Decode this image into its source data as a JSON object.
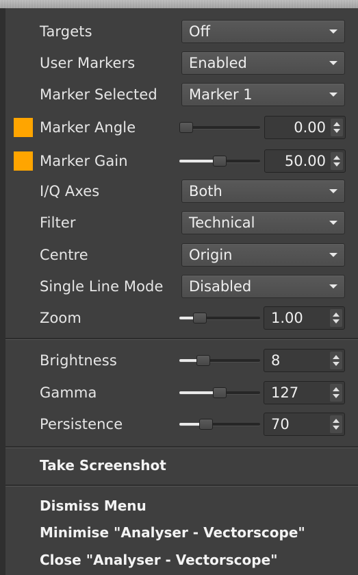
{
  "menu": {
    "targets": {
      "label": "Targets",
      "value": "Off"
    },
    "user_markers": {
      "label": "User Markers",
      "value": "Enabled"
    },
    "marker_selected": {
      "label": "Marker Selected",
      "value": "Marker 1"
    },
    "marker_angle": {
      "label": "Marker Angle",
      "value": "0.00",
      "slider_fraction": 0.0,
      "swatch_color": "#ffa500"
    },
    "marker_gain": {
      "label": "Marker Gain",
      "value": "50.00",
      "slider_fraction": 0.5,
      "swatch_color": "#ffa500"
    },
    "iq_axes": {
      "label": "I/Q Axes",
      "value": "Both"
    },
    "filter": {
      "label": "Filter",
      "value": "Technical"
    },
    "centre": {
      "label": "Centre",
      "value": "Origin"
    },
    "single_line_mode": {
      "label": "Single Line Mode",
      "value": "Disabled"
    },
    "zoom": {
      "label": "Zoom",
      "value": "1.00",
      "slider_fraction": 0.2
    },
    "brightness": {
      "label": "Brightness",
      "value": "8",
      "slider_fraction": 0.25
    },
    "gamma": {
      "label": "Gamma",
      "value": "127",
      "slider_fraction": 0.5
    },
    "persistence": {
      "label": "Persistence",
      "value": "70",
      "slider_fraction": 0.3
    },
    "take_screenshot": "Take Screenshot",
    "dismiss_menu": "Dismiss Menu",
    "minimise": "Minimise \"Analyser - Vectorscope\"",
    "close": "Close \"Analyser - Vectorscope\""
  }
}
